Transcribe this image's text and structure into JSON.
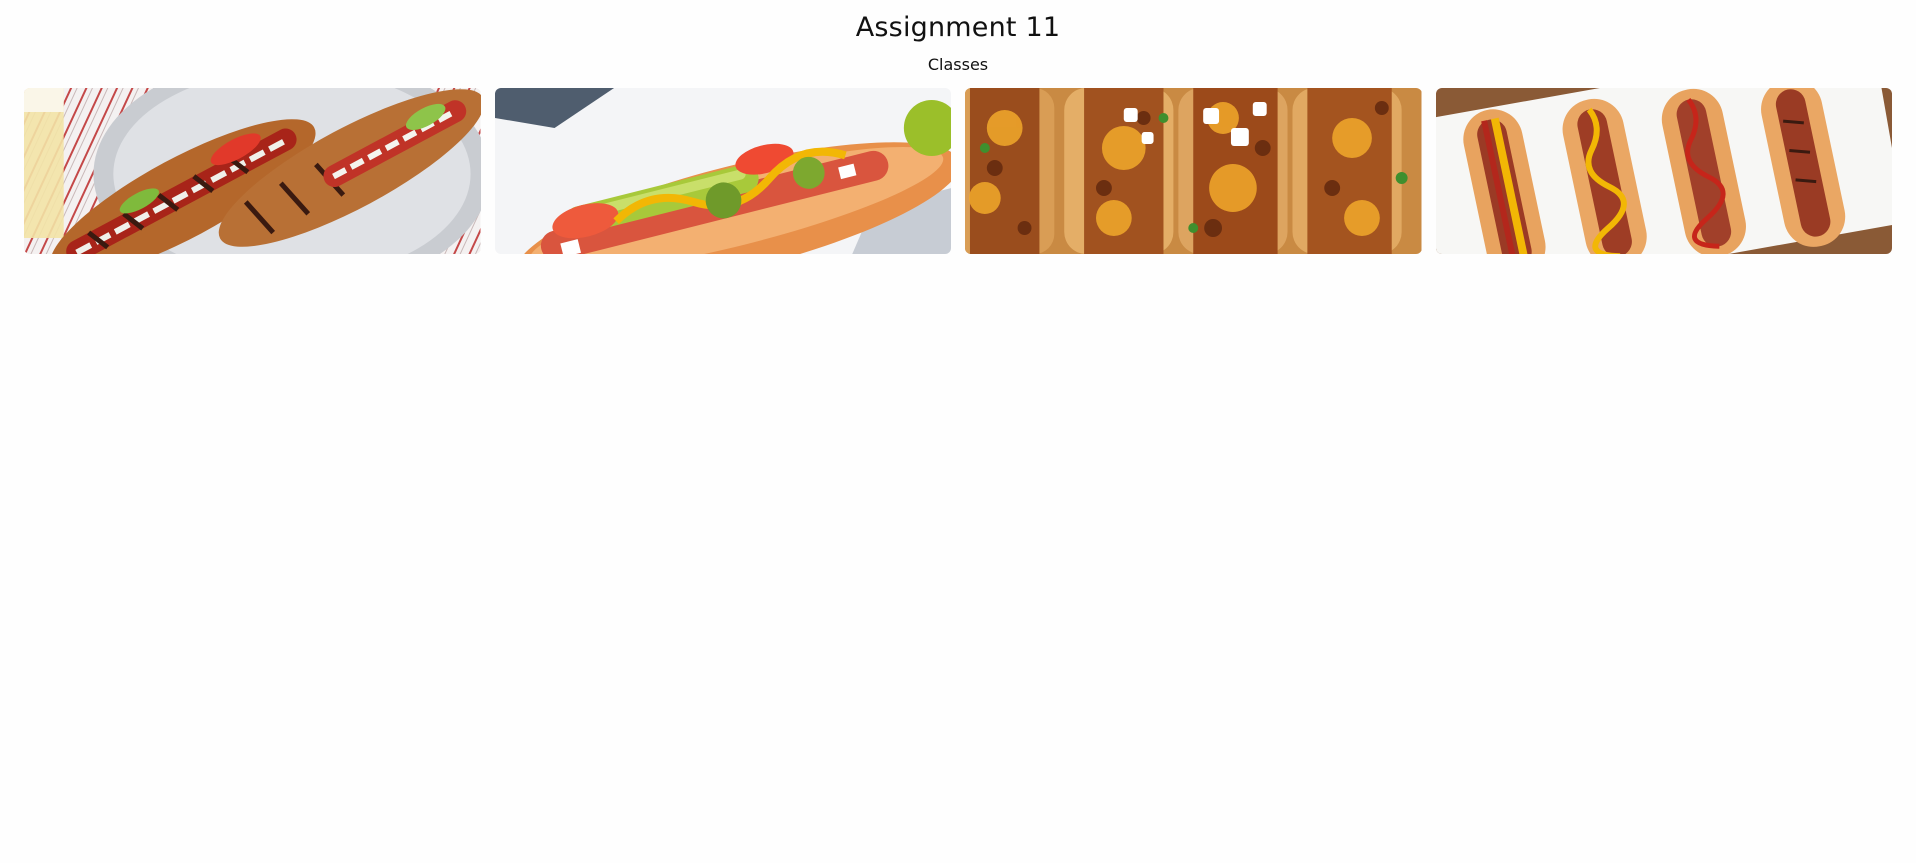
{
  "page": {
    "title": "Assignment 11",
    "subtitle": "Classes"
  },
  "gallery": {
    "images": [
      {
        "name": "grilled-hot-dogs-on-plate",
        "alt": ""
      },
      {
        "name": "chicago-style-hot-dog",
        "alt": ""
      },
      {
        "name": "chili-cheese-hot-dogs",
        "alt": ""
      },
      {
        "name": "hot-dogs-ketchup-mustard-tray",
        "alt": ""
      }
    ]
  },
  "colors": {
    "background": "#fefefe",
    "text": "#111111",
    "bun": "#d9893f",
    "sausage": "#b8352a",
    "mustard": "#f2b705",
    "relish": "#8fb82b",
    "tomato": "#e0442c"
  }
}
